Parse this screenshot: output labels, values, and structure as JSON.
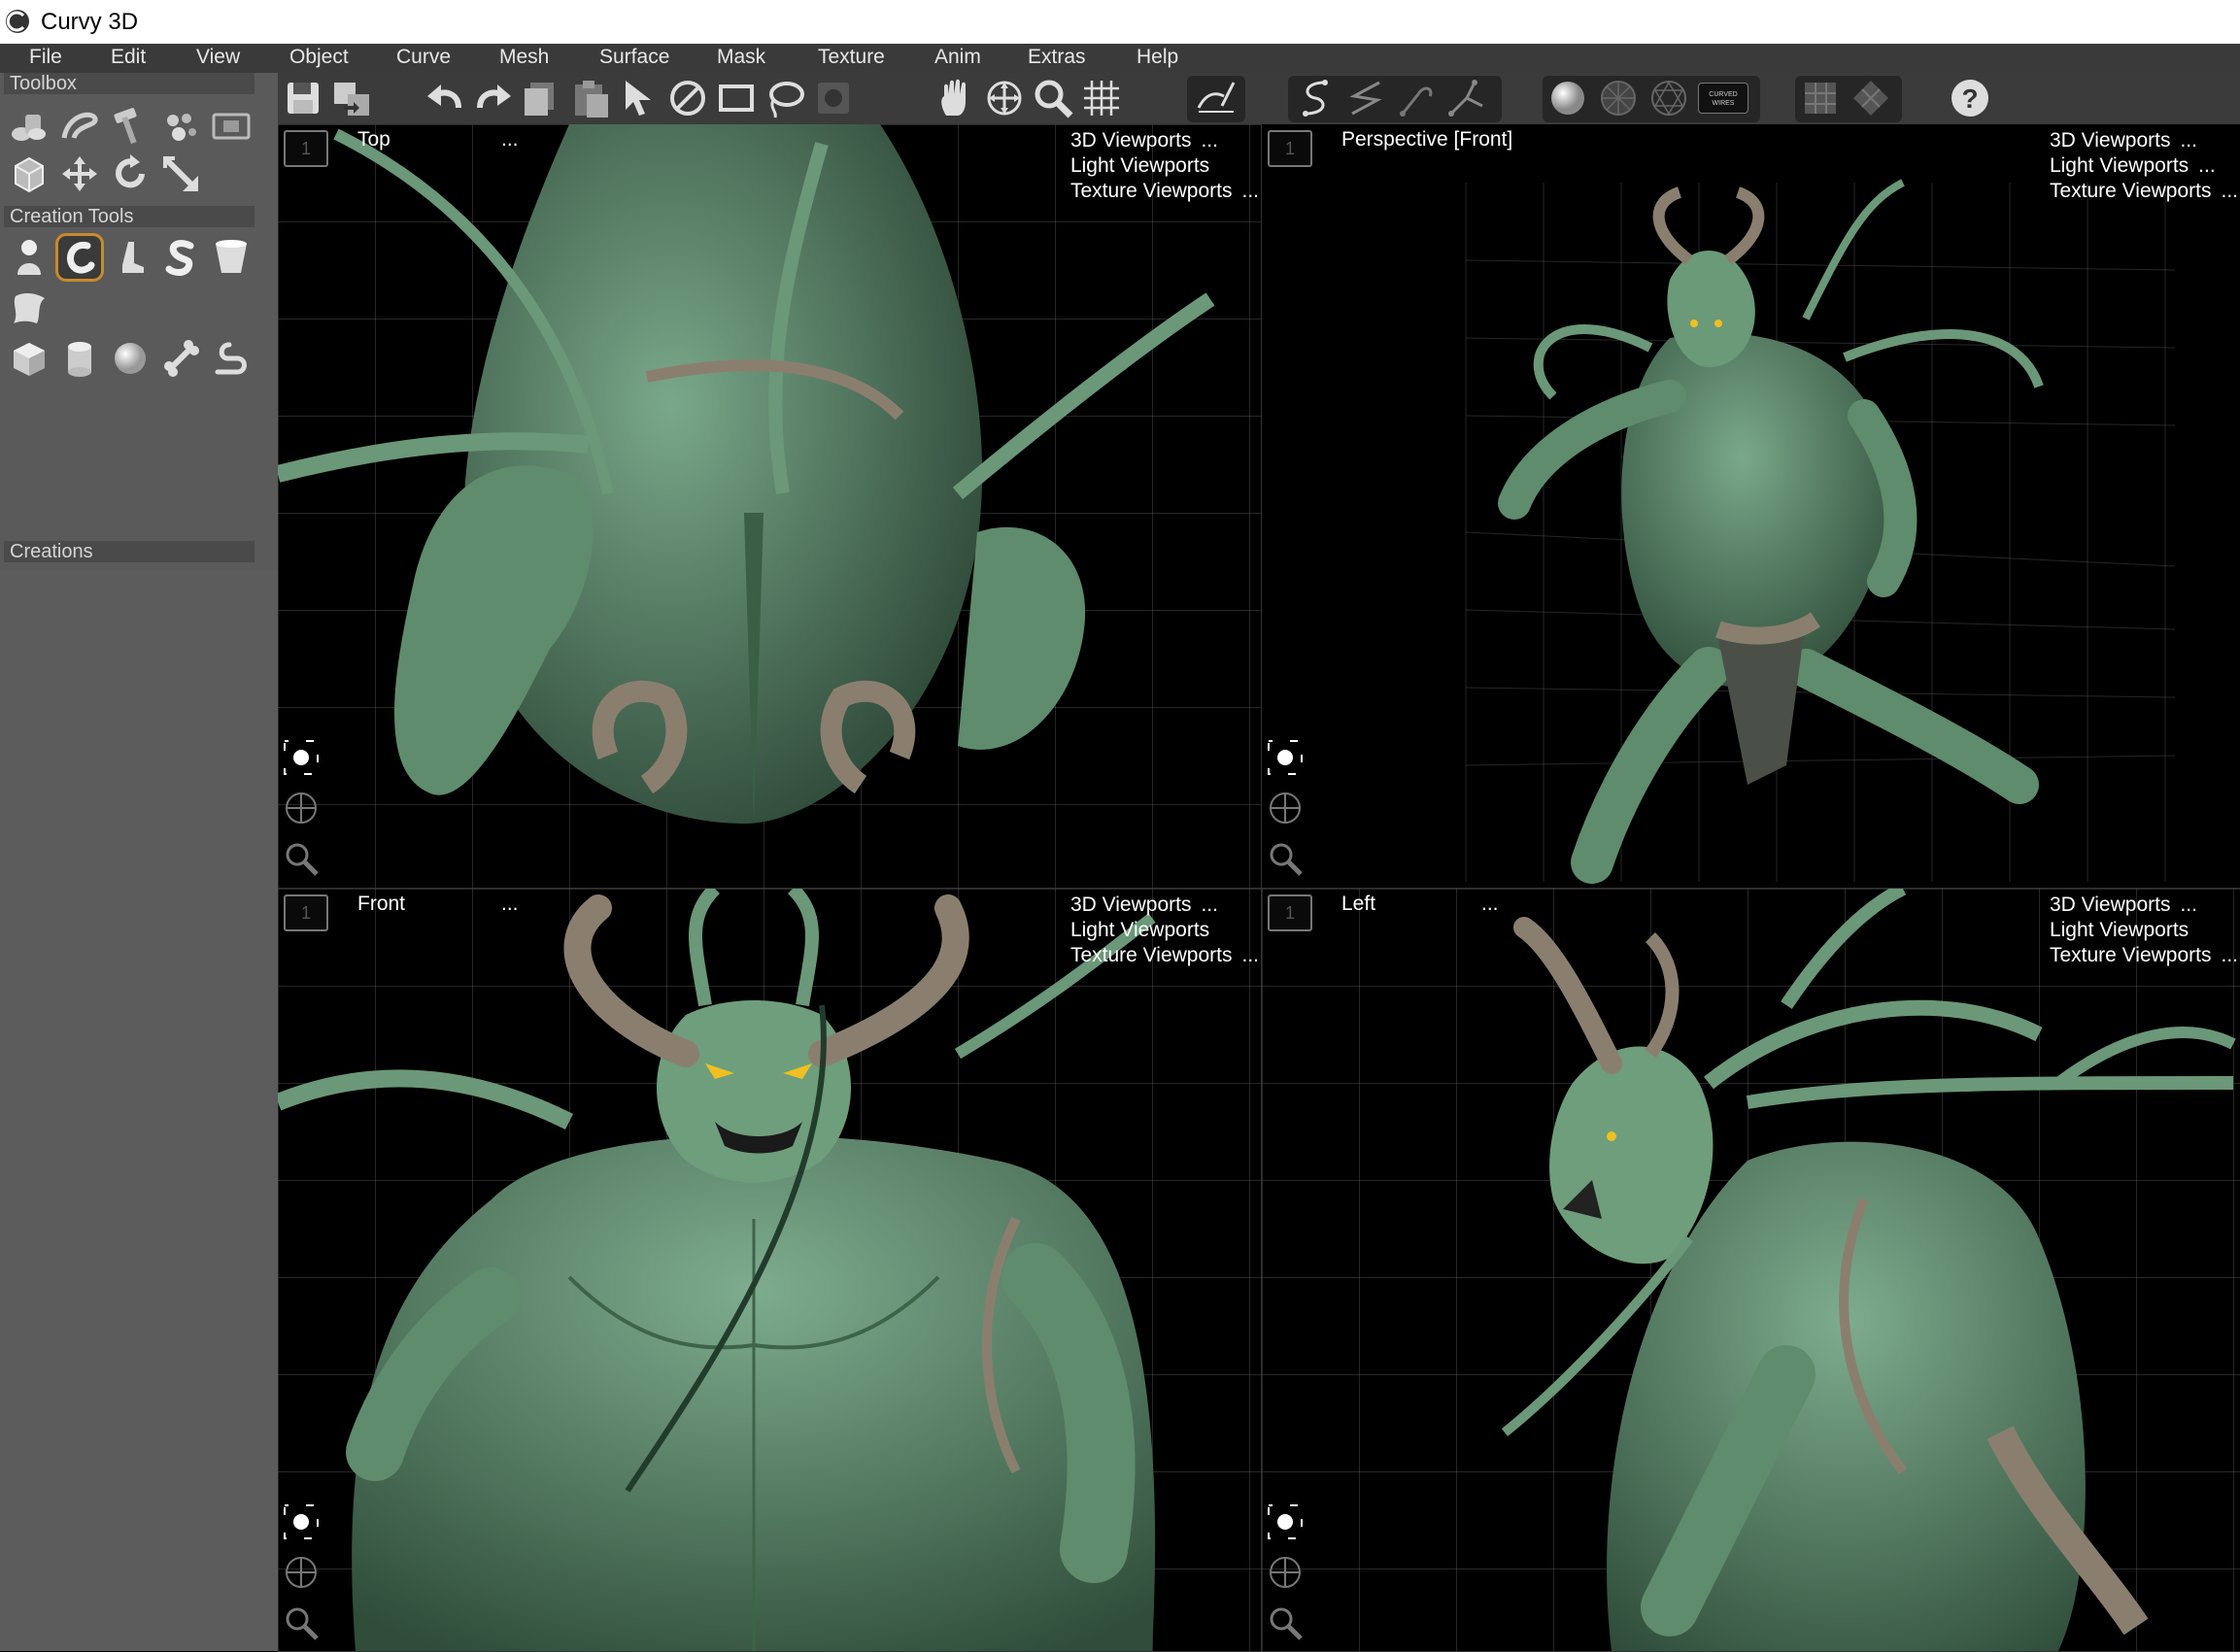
{
  "app": {
    "title": "Curvy 3D"
  },
  "menu": [
    "File",
    "Edit",
    "View",
    "Object",
    "Curve",
    "Mesh",
    "Surface",
    "Mask",
    "Texture",
    "Anim",
    "Extras",
    "Help"
  ],
  "left_panel": {
    "toolbox_label": "Toolbox",
    "creation_tools_label": "Creation Tools",
    "creations_label": "Creations"
  },
  "toolbar": {
    "wires_badge": "CURVED WIRES",
    "help_glyph": "?"
  },
  "viewports": [
    {
      "number": "1",
      "label": "Top",
      "dots": "...",
      "menu": [
        "3D Viewports",
        "Light Viewports",
        "Texture Viewports"
      ],
      "ellipsis": "..."
    },
    {
      "number": "1",
      "label": "Perspective [Front]",
      "dots": "",
      "menu": [
        "3D Viewports",
        "Light Viewports",
        "Texture Viewports"
      ],
      "ellipsis": "..."
    },
    {
      "number": "1",
      "label": "Front",
      "dots": "...",
      "menu": [
        "3D Viewports",
        "Light Viewports",
        "Texture Viewports"
      ],
      "ellipsis": "..."
    },
    {
      "number": "1",
      "label": "Left",
      "dots": "...",
      "menu": [
        "3D Viewports",
        "Light Viewports",
        "Texture Viewports"
      ],
      "ellipsis": "..."
    }
  ],
  "colors": {
    "model_green": "#5a8a6a",
    "model_dark": "#2f4d3a",
    "horn": "#8a7f6e",
    "eye": "#f0c020",
    "selected_tool": "#c98a2a",
    "viewport_bg": "#000000"
  }
}
